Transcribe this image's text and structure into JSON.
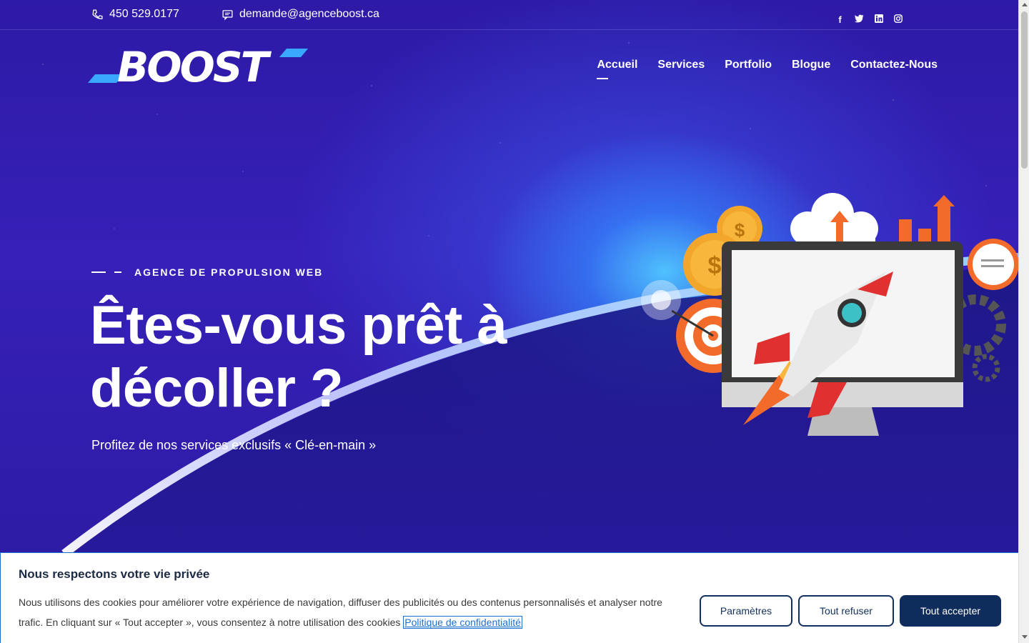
{
  "topbar": {
    "phone": "450 529.0177",
    "email": "demande@agenceboost.ca",
    "social": [
      "f",
      "t",
      "in",
      "ig"
    ]
  },
  "header": {
    "logo_text": "BOOST",
    "nav": [
      {
        "label": "Accueil",
        "active": true
      },
      {
        "label": "Services"
      },
      {
        "label": "Portfolio"
      },
      {
        "label": "Blogue"
      },
      {
        "label": "Contactez-Nous"
      }
    ]
  },
  "hero": {
    "kicker": "AGENCE DE PROPULSION WEB",
    "headline_line1": "Êtes-vous prêt à",
    "headline_line2": "décoller ?",
    "subtitle": "Profitez de nos services exclusifs « Clé-en-main »"
  },
  "cookie_banner": {
    "title": "Nous respectons votre vie privée",
    "text": "Nous utilisons des cookies pour améliorer votre expérience de navigation, diffuser des publicités ou des contenus personnalisés et analyser notre trafic. En cliquant sur « Tout accepter », vous consentez à notre utilisation des cookies ",
    "policy_link": "Politique de confidentialité",
    "btn_settings": "Paramètres",
    "btn_refuse": "Tout refuser",
    "btn_accept": "Tout accepter"
  },
  "colors": {
    "hero_bg": "#2d1aa6",
    "glow": "#50c8ff",
    "accent_blue": "#3aa8ff",
    "button_dark": "#0f2d5c"
  }
}
